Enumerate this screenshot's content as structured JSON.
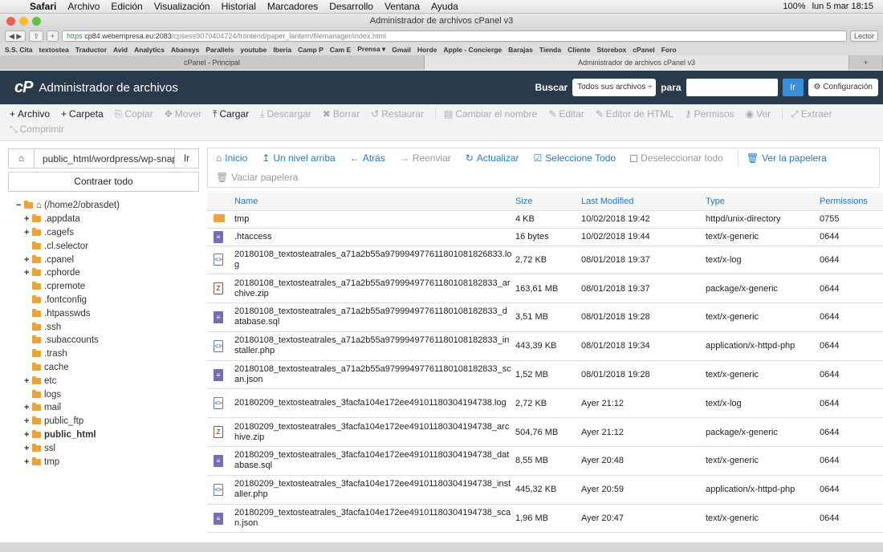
{
  "mac_menu": {
    "apple": "",
    "items": [
      "Safari",
      "Archivo",
      "Edición",
      "Visualización",
      "Historial",
      "Marcadores",
      "Desarrollo",
      "Ventana",
      "Ayuda"
    ],
    "battery": "100%",
    "datetime": "lun 5 mar  18:15"
  },
  "window": {
    "title": "Administrador de archivos cPanel v3"
  },
  "browser": {
    "url_https": "https",
    "url_host": "cp84.webempresa.eu:2083",
    "url_path": "/cpsess9079404724/frontend/paper_lantern/filemanager/index.html",
    "reader": "Lector",
    "bookmarks": [
      "S.S. Cita",
      "textostea",
      "Traductor",
      "Avid",
      "Analytics",
      "Abansys",
      "Parallels",
      "youtube",
      "Iberia",
      "Camp P",
      "Cam E",
      "Prensa ▾",
      "Gmail",
      "Horde",
      "Apple - Concierge",
      "Barajas",
      "Tienda",
      "Cliente",
      "Storebox",
      "cPanel",
      "Foro"
    ],
    "tabs": [
      "cPanel - Principal",
      "Administrador de archivos cPanel v3"
    ]
  },
  "header": {
    "logo": "cP",
    "title": "Administrador de archivos",
    "search_label": "Buscar",
    "search_scope": "Todos sus archivos ÷",
    "search_for": "para",
    "go": "Ir",
    "config": "Configuración"
  },
  "actions_row1": [
    {
      "label": "Archivo",
      "icon": "+",
      "enabled": true
    },
    {
      "label": "Carpeta",
      "icon": "+",
      "enabled": true
    },
    {
      "label": "Copiar",
      "icon": "⎘",
      "enabled": false
    },
    {
      "label": "Mover",
      "icon": "✥",
      "enabled": false
    },
    {
      "label": "Cargar",
      "icon": "⤒",
      "enabled": true
    },
    {
      "label": "Descargar",
      "icon": "⤓",
      "enabled": false
    },
    {
      "label": "Borrar",
      "icon": "✖",
      "enabled": false
    },
    {
      "label": "Restaurar",
      "icon": "↺",
      "enabled": false
    },
    {
      "label": "Cambiar el nombre",
      "icon": "▤",
      "enabled": false
    },
    {
      "label": "Editar",
      "icon": "✎",
      "enabled": false
    },
    {
      "label": "Editor de HTML",
      "icon": "✎",
      "enabled": false
    },
    {
      "label": "Permisos",
      "icon": "⚷",
      "enabled": false
    },
    {
      "label": "Ver",
      "icon": "◉",
      "enabled": false
    },
    {
      "label": "Extraer",
      "icon": "⤢",
      "enabled": false
    }
  ],
  "actions_row2": [
    {
      "label": "Comprimir",
      "icon": "⤡",
      "enabled": false
    }
  ],
  "sidebar": {
    "path_value": "public_html/wordpress/wp-snap",
    "go": "Ir",
    "collapse": "Contraer todo",
    "root": "(/home2/obrasdet)",
    "tree": [
      {
        "label": ".appdata",
        "expand": "+",
        "bold": false
      },
      {
        "label": ".cagefs",
        "expand": "+",
        "bold": false
      },
      {
        "label": ".cl.selector",
        "expand": "",
        "bold": false
      },
      {
        "label": ".cpanel",
        "expand": "+",
        "bold": false
      },
      {
        "label": ".cphorde",
        "expand": "+",
        "bold": false
      },
      {
        "label": ".cpremote",
        "expand": "",
        "bold": false
      },
      {
        "label": ".fontconfig",
        "expand": "",
        "bold": false
      },
      {
        "label": ".htpasswds",
        "expand": "",
        "bold": false
      },
      {
        "label": ".ssh",
        "expand": "",
        "bold": false
      },
      {
        "label": ".subaccounts",
        "expand": "",
        "bold": false
      },
      {
        "label": ".trash",
        "expand": "",
        "bold": false
      },
      {
        "label": "cache",
        "expand": "",
        "bold": false
      },
      {
        "label": "etc",
        "expand": "+",
        "bold": false
      },
      {
        "label": "logs",
        "expand": "",
        "bold": false
      },
      {
        "label": "mail",
        "expand": "+",
        "bold": false
      },
      {
        "label": "public_ftp",
        "expand": "+",
        "bold": false
      },
      {
        "label": "public_html",
        "expand": "+",
        "bold": true
      },
      {
        "label": "ssl",
        "expand": "+",
        "bold": false
      },
      {
        "label": "tmp",
        "expand": "+",
        "bold": false
      }
    ]
  },
  "nav": {
    "row1": [
      {
        "label": "Inicio",
        "icon": "⌂",
        "enabled": true
      },
      {
        "label": "Un nivel arriba",
        "icon": "↥",
        "enabled": true
      },
      {
        "label": "Atrás",
        "icon": "←",
        "enabled": true
      },
      {
        "label": "Reenviar",
        "icon": "→",
        "enabled": false
      },
      {
        "label": "Actualizar",
        "icon": "↻",
        "enabled": true
      },
      {
        "label": "Seleccione Todo",
        "icon": "☑",
        "enabled": true
      },
      {
        "label": "Deseleccionar todo",
        "icon": "",
        "enabled": false
      },
      {
        "label": "Ver la papelera",
        "icon": "🗑",
        "enabled": true
      }
    ],
    "row2": [
      {
        "label": "Vaciar papelera",
        "icon": "🗑",
        "enabled": false
      }
    ]
  },
  "table": {
    "headers": {
      "name": "Name",
      "size": "Size",
      "modified": "Last Modified",
      "type": "Type",
      "perms": "Permissions"
    },
    "rows": [
      {
        "icon": "folder",
        "name": "tmp",
        "size": "4 KB",
        "modified": "10/02/2018 19:42",
        "type": "httpd/unix-directory",
        "perms": "0755"
      },
      {
        "icon": "generic",
        "name": ".htaccess",
        "size": "16 bytes",
        "modified": "10/02/2018 19:44",
        "type": "text/x-generic",
        "perms": "0644"
      },
      {
        "icon": "code",
        "name": "20180108_textosteatrales_a71a2b55a979994977611801081826833.log",
        "size": "2,72 KB",
        "modified": "08/01/2018 19:37",
        "type": "text/x-log",
        "perms": "0644"
      },
      {
        "icon": "zip",
        "name": "20180108_textosteatrales_a71a2b55a97999497761180108182833_archive.zip",
        "size": "163,61 MB",
        "modified": "08/01/2018 19:37",
        "type": "package/x-generic",
        "perms": "0644"
      },
      {
        "icon": "generic",
        "name": "20180108_textosteatrales_a71a2b55a97999497761180108182833_database.sql",
        "size": "3,51 MB",
        "modified": "08/01/2018 19:28",
        "type": "text/x-generic",
        "perms": "0644"
      },
      {
        "icon": "code",
        "name": "20180108_textosteatrales_a71a2b55a97999497761180108182833_installer.php",
        "size": "443,39 KB",
        "modified": "08/01/2018 19:34",
        "type": "application/x-httpd-php",
        "perms": "0644"
      },
      {
        "icon": "generic",
        "name": "20180108_textosteatrales_a71a2b55a97999497761180108182833_scan.json",
        "size": "1,52 MB",
        "modified": "08/01/2018 19:28",
        "type": "text/x-generic",
        "perms": "0644"
      },
      {
        "icon": "code",
        "name": "20180209_textosteatrales_3facfa104e172ee49101180304194738.log",
        "size": "2,72 KB",
        "modified": "Ayer 21:12",
        "type": "text/x-log",
        "perms": "0644"
      },
      {
        "icon": "zip",
        "name": "20180209_textosteatrales_3facfa104e172ee49101180304194738_archive.zip",
        "size": "504,76 MB",
        "modified": "Ayer 21:12",
        "type": "package/x-generic",
        "perms": "0644"
      },
      {
        "icon": "generic",
        "name": "20180209_textosteatrales_3facfa104e172ee49101180304194738_database.sql",
        "size": "8,55 MB",
        "modified": "Ayer 20:48",
        "type": "text/x-generic",
        "perms": "0644"
      },
      {
        "icon": "code",
        "name": "20180209_textosteatrales_3facfa104e172ee49101180304194738_installer.php",
        "size": "445,32 KB",
        "modified": "Ayer 20:59",
        "type": "application/x-httpd-php",
        "perms": "0644"
      },
      {
        "icon": "generic",
        "name": "20180209_textosteatrales_3facfa104e172ee49101180304194738_scan.json",
        "size": "1,96 MB",
        "modified": "Ayer 20:47",
        "type": "text/x-generic",
        "perms": "0644"
      }
    ]
  }
}
